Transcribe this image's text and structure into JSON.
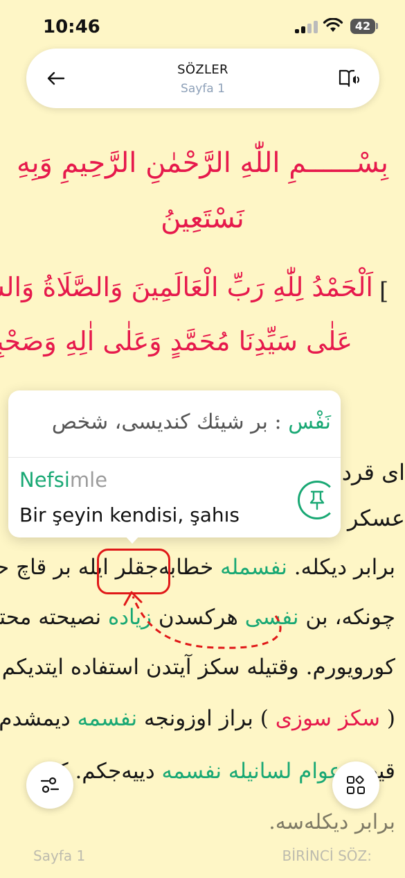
{
  "status_bar": {
    "time": "10:46",
    "battery": "42"
  },
  "header": {
    "title": "SÖZLER",
    "subtitle": "Sayfa 1"
  },
  "content": {
    "lines": [
      {
        "text": "بِسْــــــمِ اللّٰهِ الرَّحْمٰنِ الرَّحِيمِ وَبِهِ",
        "color": "#E6194C"
      },
      {
        "text": "نَسْتَعِينُ",
        "color": "#E6194C"
      },
      {
        "text": "اَلْحَمْدُ لِلّٰهِ رَبِّ الْعَالَمِينَ وَالصَّلَاةُ وَالسَّلَامُ",
        "color": "#E6194C"
      },
      {
        "text": "عَلٰى سَيِّدِنَا مُحَمَّدٍ وَعَلٰى اٰلِهِ وَصَحْبِهٖ",
        "color": "#E6194C"
      },
      {
        "text": "ای قرداش",
        "color": "#161616"
      },
      {
        "text": "عسكر او",
        "color": "#161616"
      },
      {
        "text_before": "خطابه‌جقلر ایله بر قاچ حقیقتی",
        "highlight": "نفسمله",
        "text_after": "برابر دیکله."
      },
      {
        "text_before": "چونکه، بن",
        "highlight": "نفسی",
        "text_mid": "هركسدن",
        "highlight2": "زیاده",
        "text_after": "نصیحته محتاج"
      },
      {
        "text": "كورویورم. وقتیله سكز آیتدن استفاده ایتدیکم",
        "color": "#161616"
      },
      {
        "text_before": "(",
        "highlight": "سكز سوزی",
        "text_mid": ") براز اوزونجه",
        "highlight2": "نفسمه",
        "text_after": "دیمشدم. شیمدی"
      },
      {
        "text_before": "قیصه",
        "highlight": "عوام لسانیله نفسمه",
        "text_after": "دییه‌جكم. كیم"
      },
      {
        "text": "برابر دیکله‌سه.",
        "color": "#161616"
      }
    ],
    "bracket": "["
  },
  "popup": {
    "ottoman_word": "نَفْس",
    "ottoman_definition": ": بر شیئك كندیسی، شخص",
    "word_root": "Nefsi",
    "word_suffix": "mle",
    "meaning": "Bir şeyin kendisi, şahıs"
  },
  "footer": {
    "left": "Sayfa 1",
    "right": "BİRİNCİ SÖZ:"
  },
  "colors": {
    "accent_green": "#19A874",
    "heading_red": "#E6194C",
    "page_bg": "#FEF6C6"
  },
  "icons": [
    "back-arrow-icon",
    "book-audio-icon",
    "pin-icon",
    "settings-sliders-icon",
    "grid-icon",
    "signal-icon",
    "wifi-icon",
    "battery-icon"
  ]
}
